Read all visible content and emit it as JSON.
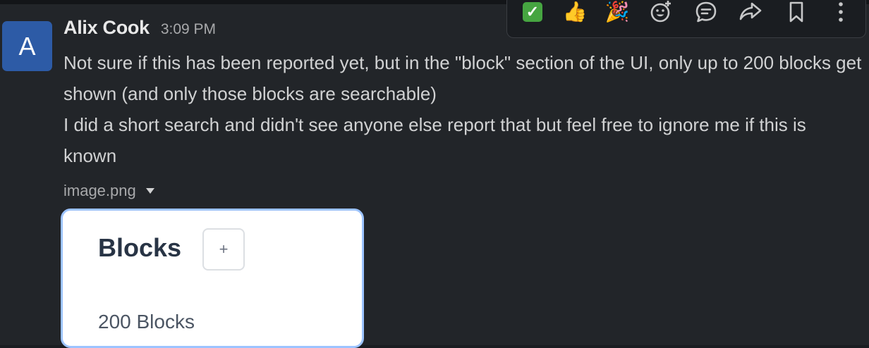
{
  "message": {
    "avatar_initial": "A",
    "author": "Alix Cook",
    "timestamp": "3:09 PM",
    "lines": [
      "Not sure if this has been reported yet, but in the \"block\" section of the UI, only up to 200 blocks get shown (and only those blocks are searchable)",
      "I did a short search and didn't see anyone else report that but feel free to ignore me if this is known"
    ]
  },
  "attachment": {
    "filename": "image.png",
    "preview": {
      "title": "Blocks",
      "add_symbol": "+",
      "count_text": "200 Blocks"
    }
  },
  "toolbar": {
    "check": "✓",
    "thumbs_up": "👍",
    "party": "🎉"
  },
  "colors": {
    "avatar": "#2d5ba6",
    "attachment_border": "#9cc3ff",
    "check": "#46a541"
  }
}
